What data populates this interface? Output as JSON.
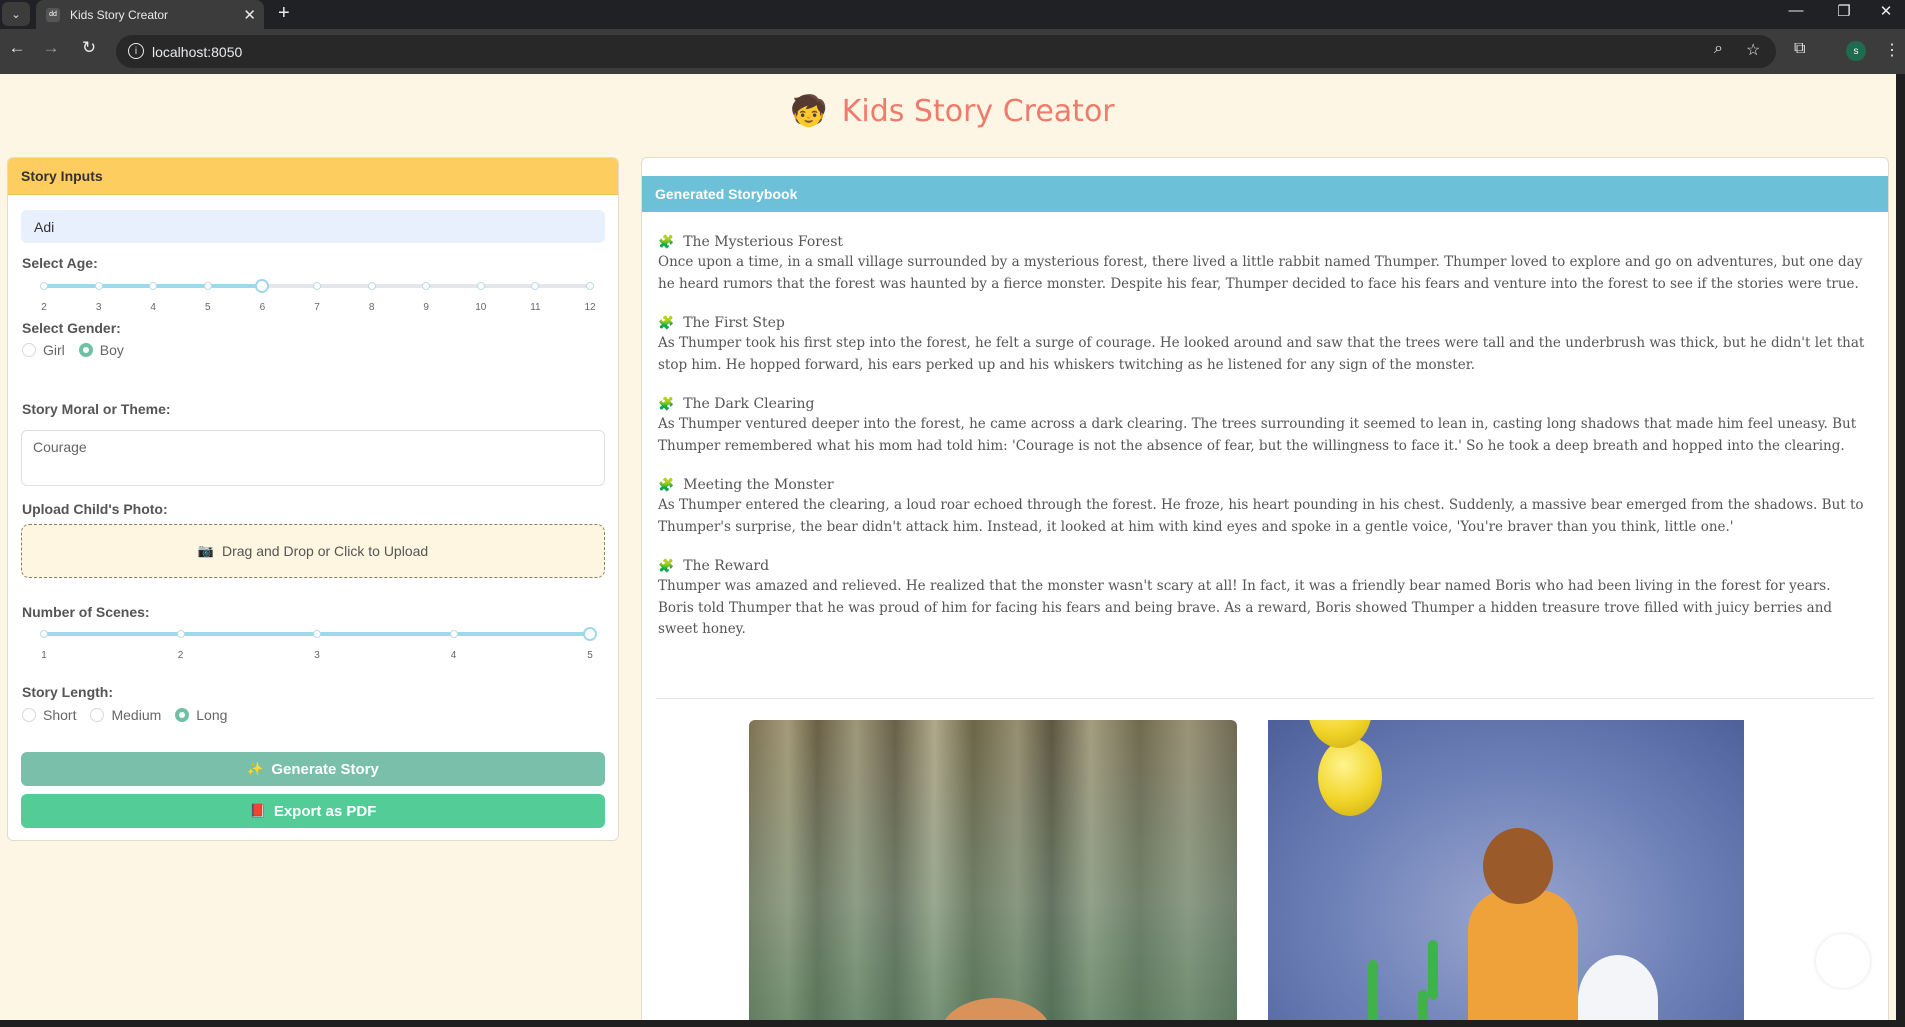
{
  "browser": {
    "tab_title": "Kids Story Creator",
    "url": "localhost:8050"
  },
  "app": {
    "title": "Kids Story Creator",
    "title_emoji": "🧒"
  },
  "inputs": {
    "header": "Story Inputs",
    "child_name": "Adi",
    "age_label": "Select Age:",
    "age_ticks": [
      "2",
      "3",
      "4",
      "5",
      "6",
      "7",
      "8",
      "9",
      "10",
      "11",
      "12"
    ],
    "age_value": 6,
    "gender_label": "Select Gender:",
    "gender_options": [
      "Girl",
      "Boy"
    ],
    "gender_selected": "Boy",
    "moral_label": "Story Moral or Theme:",
    "moral_value": "Courage",
    "upload_label": "Upload Child's Photo:",
    "upload_text": "Drag and Drop or Click to Upload",
    "upload_icon": "📷",
    "scenes_label": "Number of Scenes:",
    "scenes_ticks": [
      "1",
      "2",
      "3",
      "4",
      "5"
    ],
    "scenes_value": 5,
    "length_label": "Story Length:",
    "length_options": [
      "Short",
      "Medium",
      "Long"
    ],
    "length_selected": "Long",
    "generate_label": "Generate Story",
    "generate_icon": "✨",
    "export_label": "Export as PDF",
    "export_icon": "📕"
  },
  "storybook": {
    "header": "Generated Storybook",
    "scene_icon": "🧩",
    "scenes": [
      {
        "title": "The Mysterious Forest",
        "text": "Once upon a time, in a small village surrounded by a mysterious forest, there lived a little rabbit named Thumper. Thumper loved to explore and go on adventures, but one day he heard rumors that the forest was haunted by a fierce monster. Despite his fear, Thumper decided to face his fears and venture into the forest to see if the stories were true."
      },
      {
        "title": "The First Step",
        "text": "As Thumper took his first step into the forest, he felt a surge of courage. He looked around and saw that the trees were tall and the underbrush was thick, but he didn't let that stop him. He hopped forward, his ears perked up and his whiskers twitching as he listened for any sign of the monster."
      },
      {
        "title": "The Dark Clearing",
        "text": "As Thumper ventured deeper into the forest, he came across a dark clearing. The trees surrounding it seemed to lean in, casting long shadows that made him feel uneasy. But Thumper remembered what his mom had told him: 'Courage is not the absence of fear, but the willingness to face it.' So he took a deep breath and hopped into the clearing."
      },
      {
        "title": "Meeting the Monster",
        "text": "As Thumper entered the clearing, a loud roar echoed through the forest. He froze, his heart pounding in his chest. Suddenly, a massive bear emerged from the shadows. But to Thumper's surprise, the bear didn't attack him. Instead, it looked at him with kind eyes and spoke in a gentle voice, 'You're braver than you think, little one.'"
      },
      {
        "title": "The Reward",
        "text": "Thumper was amazed and relieved. He realized that the monster wasn't scary at all! In fact, it was a friendly bear named Boris who had been living in the forest for years. Boris told Thumper that he was proud of him for facing his fears and being brave. As a reward, Boris showed Thumper a hidden treasure trove filled with juicy berries and sweet honey."
      }
    ]
  }
}
